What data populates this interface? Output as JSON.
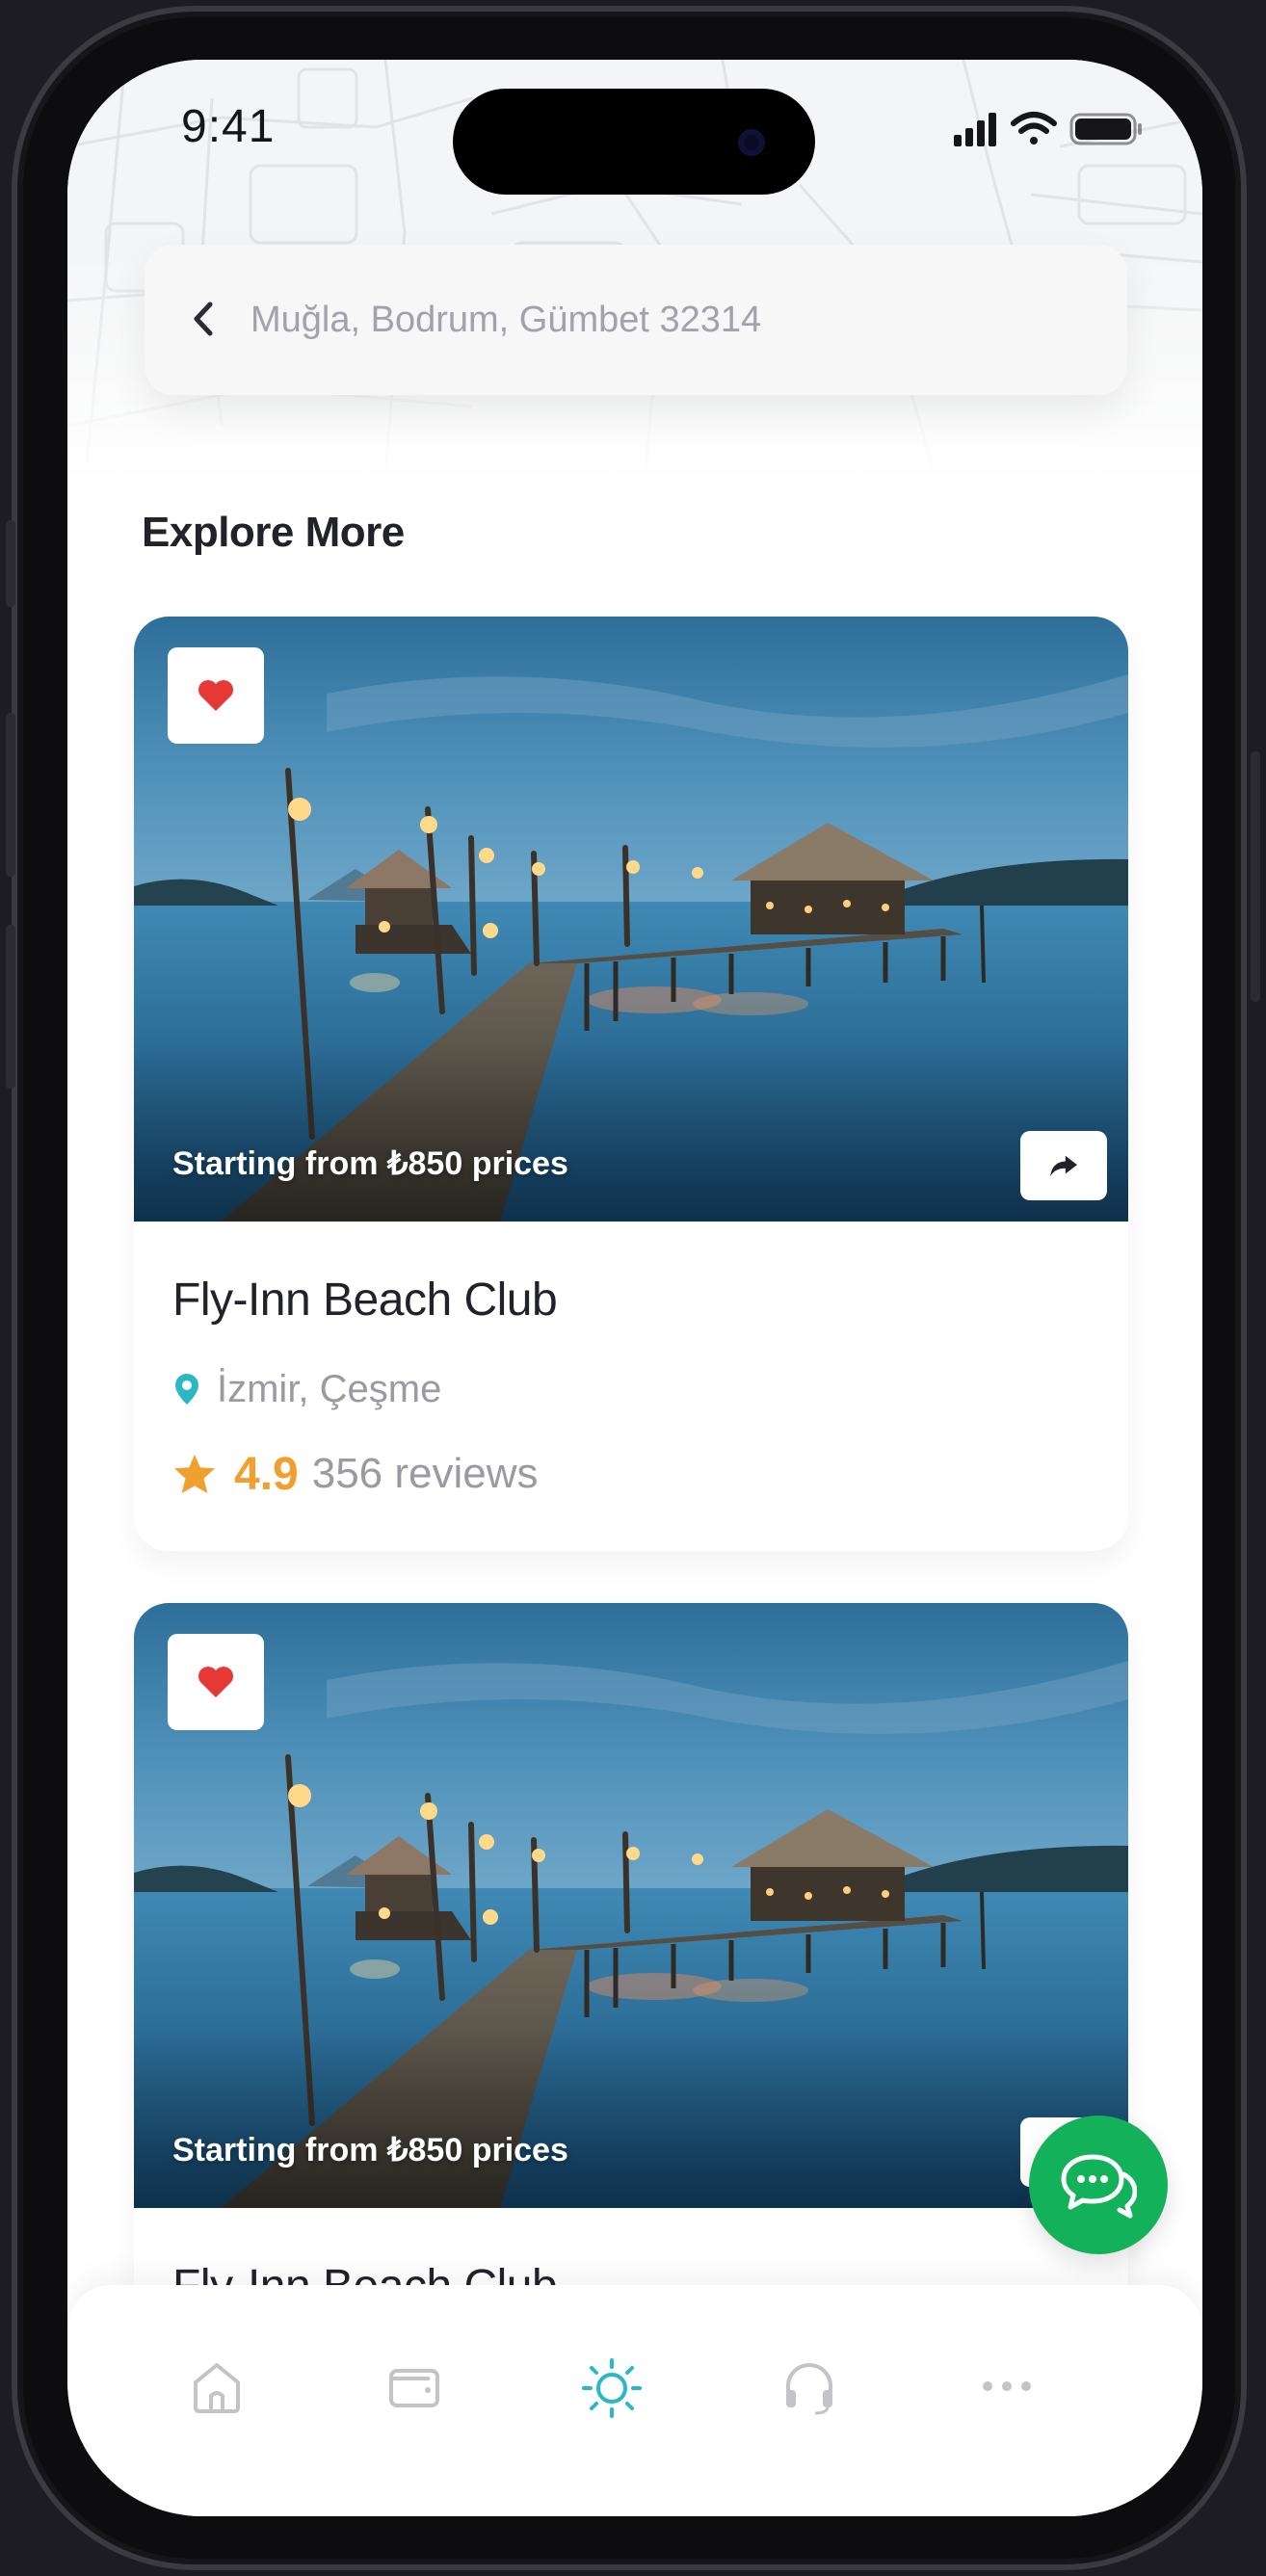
{
  "status_bar": {
    "time": "9:41"
  },
  "search": {
    "text": "Muğla, Bodrum, Gümbet 32314"
  },
  "section_title": "Explore More",
  "cards": [
    {
      "price_label": "Starting from ₺850 prices",
      "title": "Fly-Inn Beach Club",
      "location": "İzmir, Çeşme",
      "rating": "4.9",
      "reviews": "356 reviews",
      "favorited": true
    },
    {
      "price_label": "Starting from ₺850 prices",
      "title": "Fly-Inn Beach Club",
      "favorited": true
    }
  ],
  "tabs": [
    {
      "name": "home",
      "icon": "home-icon",
      "active": false
    },
    {
      "name": "wallet",
      "icon": "wallet-icon",
      "active": false
    },
    {
      "name": "explore",
      "icon": "sun-icon",
      "active": true
    },
    {
      "name": "support",
      "icon": "headphones-icon",
      "active": false
    },
    {
      "name": "more",
      "icon": "more-icon",
      "active": false
    }
  ],
  "colors": {
    "accent": "#2ab7c6",
    "favorite": "#e53935",
    "rating_star": "#f0a030",
    "chat_fab": "#13b159",
    "tab_inactive": "#c4c4c8"
  }
}
